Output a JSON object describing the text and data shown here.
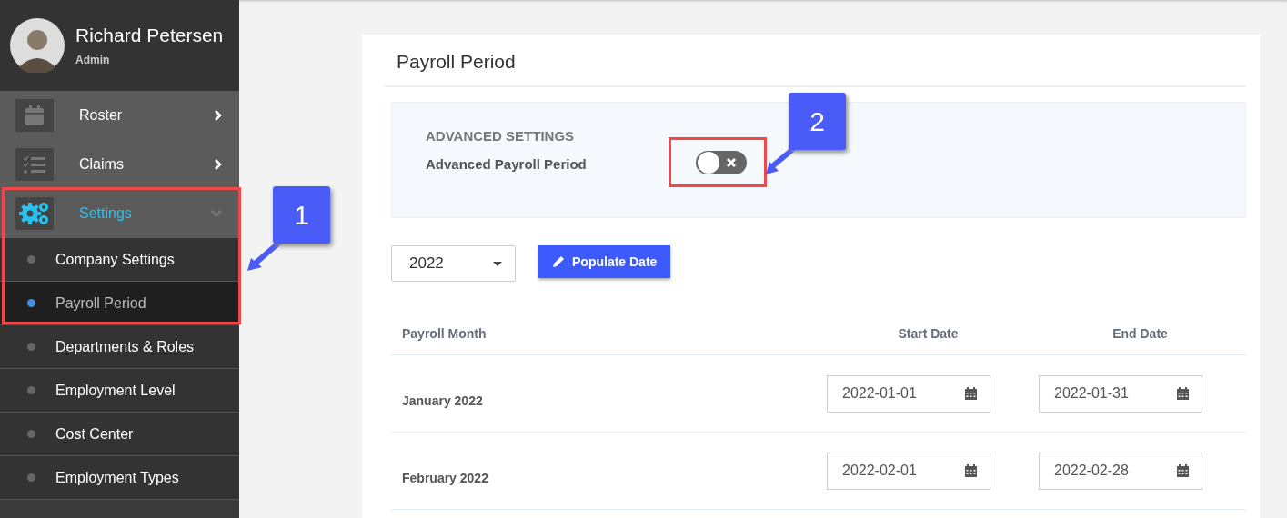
{
  "user": {
    "name": "Richard Petersen",
    "role": "Admin"
  },
  "menu": [
    {
      "label": "Roster",
      "selected": false,
      "expanded": false
    },
    {
      "label": "Claims",
      "selected": false,
      "expanded": false
    },
    {
      "label": "Settings",
      "selected": true,
      "expanded": true,
      "children": [
        {
          "label": "Company Settings",
          "selected": false
        },
        {
          "label": "Payroll Period",
          "selected": true
        },
        {
          "label": "Departments & Roles",
          "selected": false
        },
        {
          "label": "Employment Level",
          "selected": false
        },
        {
          "label": "Cost Center",
          "selected": false
        },
        {
          "label": "Employment Types",
          "selected": false
        }
      ]
    }
  ],
  "page": {
    "title": "Payroll Period",
    "advanced": {
      "heading": "ADVANCED SETTINGS",
      "label": "Advanced Payroll Period",
      "on": false
    },
    "year_select": {
      "value": "2022"
    },
    "populate_button": "Populate Date",
    "table": {
      "columns": [
        "Payroll Month",
        "Start Date",
        "End Date"
      ],
      "rows": [
        {
          "month": "January 2022",
          "start": "2022-01-01",
          "end": "2022-01-31"
        },
        {
          "month": "February 2022",
          "start": "2022-02-01",
          "end": "2022-02-28"
        }
      ]
    }
  },
  "annotations": [
    {
      "label": "1"
    },
    {
      "label": "2"
    }
  ]
}
